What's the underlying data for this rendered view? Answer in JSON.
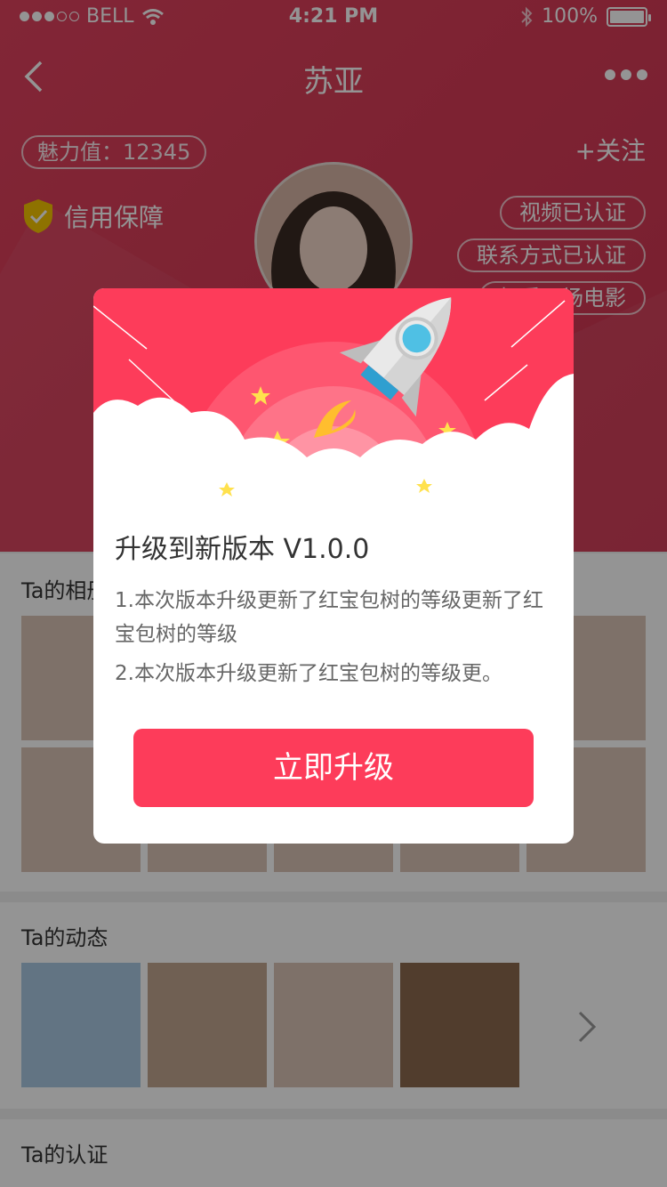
{
  "status_bar": {
    "carrier": "BELL",
    "time": "4:21 PM",
    "battery": "100%"
  },
  "nav": {
    "title": "苏亚"
  },
  "profile": {
    "charm": "魅力值：12345",
    "follow": "+关注",
    "credit": "信用保障",
    "tags": [
      "视频已认证",
      "联系方式已认证",
      "想看一场电影"
    ]
  },
  "sections": {
    "photos_title": "Ta的相册",
    "moments_title": "Ta的动态",
    "cert_title": "Ta的认证"
  },
  "modal": {
    "title": "升级到新版本  V1.0.0",
    "items": [
      "1.本次版本升级更新了红宝包树的等级更新了红宝包树的等级",
      "2.本次版本升级更新了红宝包树的等级更。"
    ],
    "button": "立即升级"
  },
  "colors": {
    "accent": "#fd3c5a",
    "header": "#d93d58",
    "shield": "#f5c400"
  }
}
